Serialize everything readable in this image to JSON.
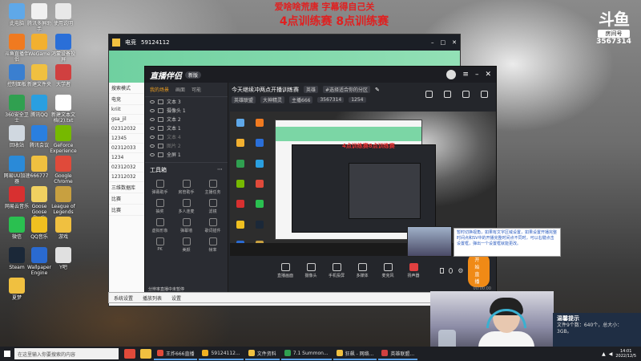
{
  "overlay": {
    "line1": "爱啥啥荒唐 字幕得自己关",
    "line2": "4点训练赛  8点训练赛"
  },
  "douyu_badge": {
    "logo": "斗鱼",
    "label": "房间号",
    "room": "3567314"
  },
  "desktop_icons": [
    {
      "label": "此电脑",
      "color": "#5fa8e8"
    },
    {
      "label": "腾讯多屏助手",
      "color": "#f0f0f0"
    },
    {
      "label": "使用说明",
      "color": "#e8e8e8"
    },
    {
      "label": "斗鱼直播伴侣",
      "color": "#f07a20"
    },
    {
      "label": "WeGame",
      "color": "#f2b030"
    },
    {
      "label": "鸿蒙设备投屏",
      "color": "#2a6fd8"
    },
    {
      "label": "控制面板",
      "color": "#3a7fd0"
    },
    {
      "label": "新建文件夹",
      "color": "#f0c040"
    },
    {
      "label": "大学者",
      "color": "#d04040"
    },
    {
      "label": "360安全卫士",
      "color": "#30a050"
    },
    {
      "label": "腾讯QQ",
      "color": "#2a9fe0"
    },
    {
      "label": "新建文本文档(2).txt",
      "color": "#ffffff"
    },
    {
      "label": "回收站",
      "color": "#d0d8e0"
    },
    {
      "label": "腾讯会议",
      "color": "#2a7fe0"
    },
    {
      "label": "GeForce Experience",
      "color": "#76b900"
    },
    {
      "label": "网易UU加速器",
      "color": "#2a8ad8"
    },
    {
      "label": "666777",
      "color": "#f0c040"
    },
    {
      "label": "Google Chrome",
      "color": "#e04a3a"
    },
    {
      "label": "网易云音乐",
      "color": "#d83030"
    },
    {
      "label": "Goose Goose Duck",
      "color": "#f0d060"
    },
    {
      "label": "League of Legends",
      "color": "#c8a040"
    },
    {
      "label": "微信",
      "color": "#2ac050"
    },
    {
      "label": "QQ音乐",
      "color": "#f0c020"
    },
    {
      "label": "游戏",
      "color": "#f0c040"
    },
    {
      "label": "Steam",
      "color": "#1b2838"
    },
    {
      "label": "Wallpaper Engine",
      "color": "#2a6ad0"
    },
    {
      "label": "Y吧",
      "color": "#e0e0e0"
    },
    {
      "label": "夏梦",
      "color": "#f0c040"
    }
  ],
  "backdrop_window": {
    "title": "电竞",
    "room": "59124112",
    "sidebar": [
      "搜索模式",
      "电竞",
      "kriit",
      "gsa_jil",
      "02312032",
      "12345",
      "02312033",
      "1234",
      "02312032",
      "12312032",
      "三维数据库",
      "比赛",
      "比赛"
    ],
    "bottom_items": [
      "系统设置",
      "播放列表",
      "设置"
    ]
  },
  "broadcaster": {
    "brand": "直播伴侣",
    "version": "新版",
    "tabs": [
      "我的场景",
      "画面",
      "可能"
    ],
    "scenes": [
      {
        "label": "文本 3",
        "dim": false
      },
      {
        "label": "摄像头 1",
        "dim": false
      },
      {
        "label": "文本 2",
        "dim": false
      },
      {
        "label": "文本 1",
        "dim": false
      },
      {
        "label": "文本 4",
        "dim": true
      },
      {
        "label": "图片 2",
        "dim": true
      },
      {
        "label": "全屏 1",
        "dim": false
      }
    ],
    "tools_header": "工具箱",
    "tools": [
      "弹幕助手",
      "房管助手",
      "主播任务",
      "抽奖",
      "多人连麦",
      "滤镜",
      "虚拟形象",
      "弹幕墙",
      "歌词插件",
      "PK",
      "美颜",
      "帧率"
    ],
    "stream_title": "今天继续冲两点开播训练赛",
    "stream_tag": "英雄",
    "stream_sub": "#选择适合你的分区",
    "meta": [
      "英雄联盟",
      "大神精灵",
      "主播666",
      "3567314",
      "1254"
    ],
    "preview_red": "4点训练赛8点训练赛",
    "controls": [
      {
        "label": "直播画面",
        "red": false
      },
      {
        "label": "摄像头",
        "red": false
      },
      {
        "label": "手机投屏",
        "red": false
      },
      {
        "label": "多媒体",
        "red": false
      },
      {
        "label": "麦克风",
        "red": false
      },
      {
        "label": "扬声器",
        "red": true
      }
    ],
    "live_button": "开始直播",
    "status_left": "分辨率直播中未暂停",
    "status_time": "00:00:00"
  },
  "notice": {
    "text": "暂时切换视角，如果有文字区域设置，如果设置开播完整时间点和SV中的开播完整时间点不同时，可以右键点击设置框，弹出一个设置框就能更改。"
  },
  "toast": {
    "title": "温馨提示",
    "line1": "文件9个数：640个，总大小：",
    "line2": "3GB。"
  },
  "taskbar": {
    "search_placeholder": "在这里输入你要搜索的内容",
    "apps": [
      {
        "label": "王炸666直播",
        "color": "#e04a3a"
      },
      {
        "label": "59124112...",
        "color": "#f0b020"
      },
      {
        "label": "文件资料",
        "color": "#f0c040"
      },
      {
        "label": "7.1 Summon...",
        "color": "#30a050"
      },
      {
        "label": "狂飙 - 网络...",
        "color": "#f0c040"
      },
      {
        "label": "英雄联盟...",
        "color": "#d04040"
      }
    ],
    "time": "14:01",
    "date": "2022/12/5"
  }
}
